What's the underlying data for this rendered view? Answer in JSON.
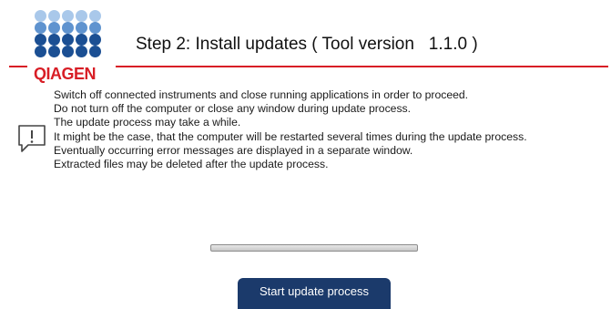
{
  "logo": {
    "text": "QIAGEN",
    "colors": {
      "light": "#a9c8ea",
      "mid": "#5f93cf",
      "dark": "#1b4f93",
      "text": "#d81e26"
    }
  },
  "header": {
    "title": "Step 2: Install updates ( Tool version   1.1.0 )"
  },
  "info": {
    "icon": "info-speech-bubble-icon",
    "lines": [
      "Switch off connected instruments and close running applications in order to proceed.",
      "Do not turn off the computer or close any window during update process.",
      "The update process may take a while.",
      "It might be the case, that the computer will be restarted several times during the update process.",
      "Eventually occurring error messages are displayed in a separate window.",
      "Extracted files may be deleted after the update process."
    ]
  },
  "progress": {
    "fraction": 0
  },
  "actions": {
    "start_label": "Start update process"
  },
  "accent": {
    "red": "#d81e26",
    "button": "#1b3a6b"
  }
}
